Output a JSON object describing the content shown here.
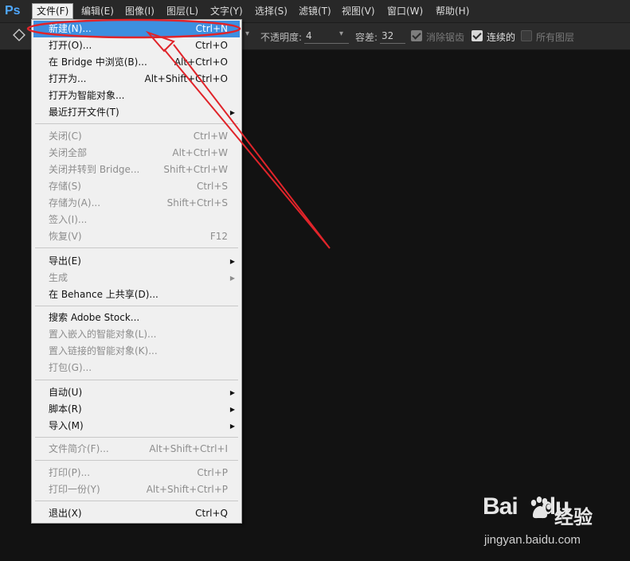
{
  "app": {
    "logo": "Ps"
  },
  "menubar": {
    "items": [
      {
        "label": "文件(F)",
        "active": true
      },
      {
        "label": "编辑(E)"
      },
      {
        "label": "图像(I)"
      },
      {
        "label": "图层(L)"
      },
      {
        "label": "文字(Y)"
      },
      {
        "label": "选择(S)"
      },
      {
        "label": "滤镜(T)"
      },
      {
        "label": "视图(V)"
      },
      {
        "label": "窗口(W)"
      },
      {
        "label": "帮助(H)"
      }
    ]
  },
  "options": {
    "opacity_label": "不透明度:",
    "opacity_value": "4",
    "tolerance_label": "容差:",
    "tolerance_value": "32",
    "antialias_label": "消除锯齿",
    "antialias_checked": true,
    "contiguous_label": "连续的",
    "contiguous_checked": true,
    "all_layers_label": "所有图层",
    "all_layers_checked": false
  },
  "file_menu": {
    "items": [
      {
        "label": "新建(N)...",
        "shortcut": "Ctrl+N",
        "highlighted": true
      },
      {
        "label": "打开(O)...",
        "shortcut": "Ctrl+O"
      },
      {
        "label": "在 Bridge 中浏览(B)...",
        "shortcut": "Alt+Ctrl+O"
      },
      {
        "label": "打开为...",
        "shortcut": "Alt+Shift+Ctrl+O"
      },
      {
        "label": "打开为智能对象..."
      },
      {
        "label": "最近打开文件(T)",
        "submenu": true
      },
      {
        "label": "关闭(C)",
        "shortcut": "Ctrl+W",
        "disabled": true
      },
      {
        "label": "关闭全部",
        "shortcut": "Alt+Ctrl+W",
        "disabled": true
      },
      {
        "label": "关闭并转到 Bridge...",
        "shortcut": "Shift+Ctrl+W",
        "disabled": true
      },
      {
        "label": "存储(S)",
        "shortcut": "Ctrl+S",
        "disabled": true
      },
      {
        "label": "存储为(A)...",
        "shortcut": "Shift+Ctrl+S",
        "disabled": true
      },
      {
        "label": "签入(I)...",
        "disabled": true
      },
      {
        "label": "恢复(V)",
        "shortcut": "F12",
        "disabled": true
      },
      {
        "label": "导出(E)",
        "submenu": true
      },
      {
        "label": "生成",
        "submenu": true,
        "disabled": true
      },
      {
        "label": "在 Behance 上共享(D)..."
      },
      {
        "label": "搜索 Adobe Stock..."
      },
      {
        "label": "置入嵌入的智能对象(L)...",
        "disabled": true
      },
      {
        "label": "置入链接的智能对象(K)...",
        "disabled": true
      },
      {
        "label": "打包(G)...",
        "disabled": true
      },
      {
        "label": "自动(U)",
        "submenu": true
      },
      {
        "label": "脚本(R)",
        "submenu": true
      },
      {
        "label": "导入(M)",
        "submenu": true
      },
      {
        "label": "文件简介(F)...",
        "shortcut": "Alt+Shift+Ctrl+I",
        "disabled": true
      },
      {
        "label": "打印(P)...",
        "shortcut": "Ctrl+P",
        "disabled": true
      },
      {
        "label": "打印一份(Y)",
        "shortcut": "Alt+Shift+Ctrl+P",
        "disabled": true
      },
      {
        "label": "退出(X)",
        "shortcut": "Ctrl+Q"
      }
    ]
  },
  "annotation": {
    "color": "#e0242a"
  },
  "watermark": {
    "brand_left": "Bai",
    "brand_right": "du",
    "brand_cn": "经验",
    "url": "jingyan.baidu.com"
  }
}
